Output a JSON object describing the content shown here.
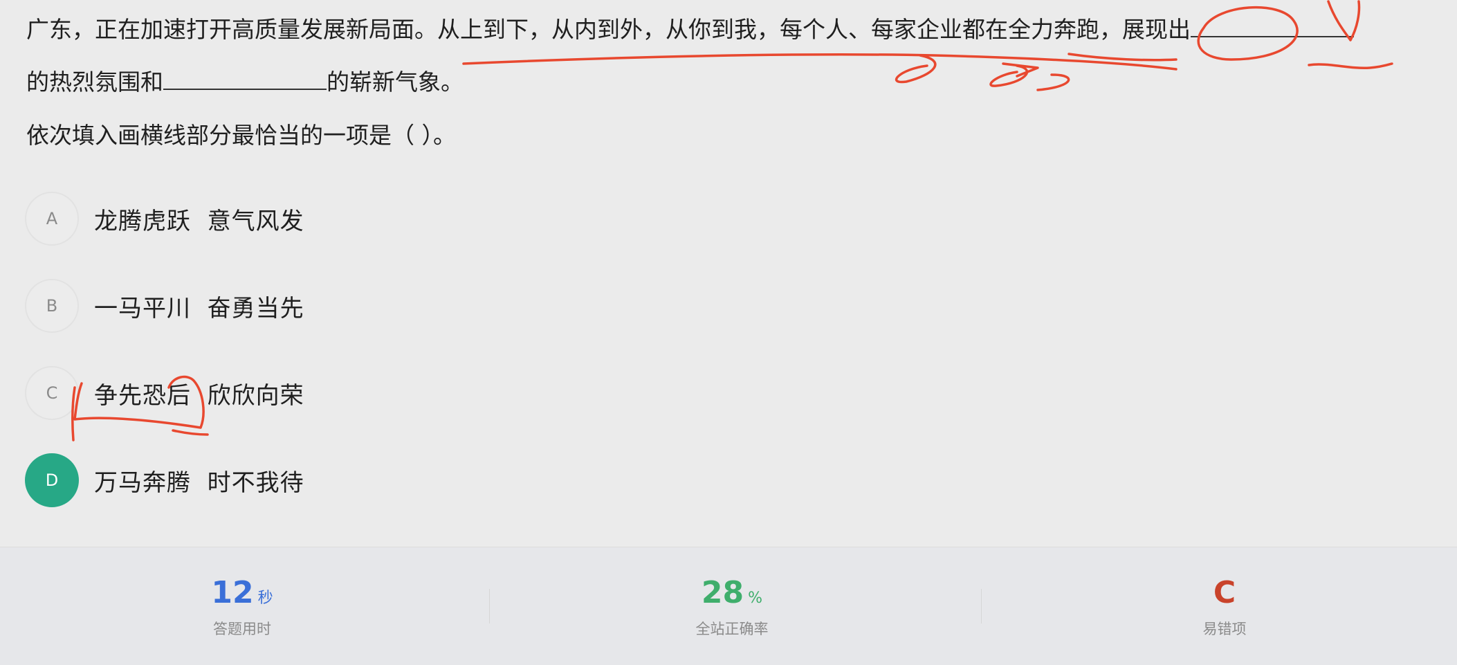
{
  "question": {
    "line1_text": "广东，正在加速打开高质量发展新局面。从上到下，从内到外，从你到我，每个人、每家企业都在全力奔跑，展现出",
    "line2_before": "的热烈氛围和",
    "line2_after": "的崭新气象。",
    "line3_text": "依次填入画横线部分最恰当的一项是（    ）。"
  },
  "options": [
    {
      "letter": "A",
      "text": "龙腾虎跃  意气风发",
      "selected": false
    },
    {
      "letter": "B",
      "text": "一马平川  奋勇当先",
      "selected": false
    },
    {
      "letter": "C",
      "text": "争先恐后  欣欣向荣",
      "selected": false
    },
    {
      "letter": "D",
      "text": "万马奔腾  时不我待",
      "selected": true
    }
  ],
  "stats": {
    "time": {
      "value": "12",
      "unit": "秒",
      "label": "答题用时",
      "color": "#3a6fd8"
    },
    "accuracy": {
      "value": "28",
      "unit": "%",
      "label": "全站正确率",
      "color": "#3fae6c"
    },
    "error_prone": {
      "value": "C",
      "label": "易错项",
      "color": "#c9432b"
    }
  },
  "colors": {
    "annotation": "#e8482f",
    "selected_option": "#27a886"
  }
}
